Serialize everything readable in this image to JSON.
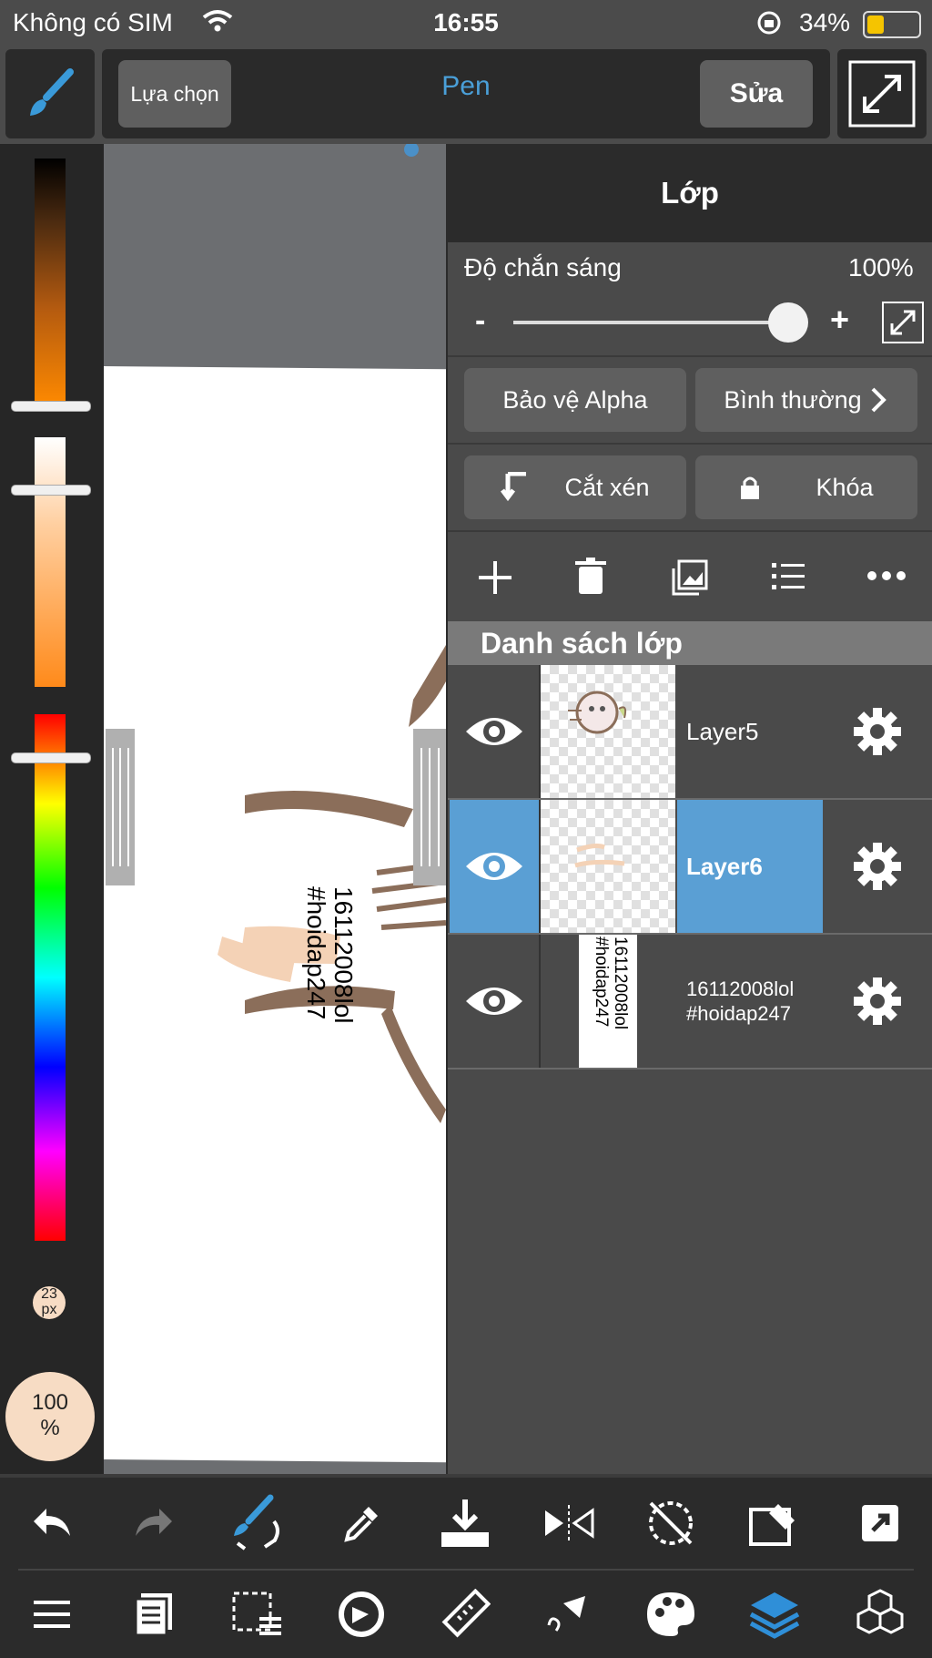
{
  "status_bar": {
    "carrier": "Không có SIM",
    "time": "16:55",
    "battery": "34%"
  },
  "top_bar": {
    "selection_label": "Lựa chọn",
    "tool_name": "Pen",
    "edit_label": "Sửa"
  },
  "left_panel": {
    "brush_size": "23",
    "brush_unit": "px",
    "opacity": "100",
    "opacity_unit": "%"
  },
  "canvas": {
    "text_line1": "16112008lol",
    "text_line2": "#hoidap247"
  },
  "layer_panel": {
    "title": "Lớp",
    "opacity_label": "Độ chắn sáng",
    "opacity_value": "100%",
    "opacity_level": 1.0,
    "minus": "-",
    "plus": "+",
    "alpha_protect": "Bảo vệ Alpha",
    "blend_mode": "Bình thường",
    "clipping": "Cắt xén",
    "lock": "Khóa",
    "list_header": "Danh sách lớp",
    "layers": [
      {
        "name": "Layer5",
        "selected": false
      },
      {
        "name": "Layer6",
        "selected": true
      },
      {
        "name_line1": "16112008lol",
        "name_line2": "#hoidap247",
        "selected": false
      }
    ]
  },
  "colors": {
    "accent": "#4a90c8",
    "selected_row": "#5a9fd4",
    "panel": "#4a4a4a"
  }
}
